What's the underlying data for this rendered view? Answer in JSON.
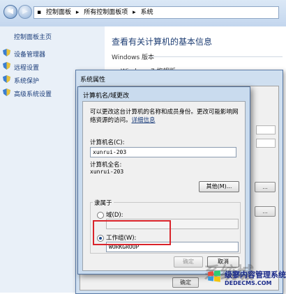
{
  "address_bar": {
    "crumbs": [
      "控制面板",
      "▸",
      "所有控制面板项",
      "▸",
      "系统"
    ]
  },
  "left_nav": {
    "home": "控制面板主页",
    "items": [
      "设备管理器",
      "远程设置",
      "系统保护",
      "高级系统设置"
    ]
  },
  "main": {
    "title": "查看有关计算机的基本信息",
    "windows_version_label": "Windows 版本",
    "windows_edition": "Windows 7 旗舰版"
  },
  "system_properties": {
    "title": "系统属性",
    "ok": "确定"
  },
  "name_dialog": {
    "title": "计算机名/域更改",
    "description_line1": "可以更改这台计算机的名称和成员身份。更改可能影响网",
    "description_line2": "络资源的访问。",
    "more_info_link": "详细信息",
    "computer_name_label": "计算机名(C):",
    "computer_name_value": "xunrui-203",
    "full_name_label": "计算机全名:",
    "full_name_value": "xunrui-203",
    "other_button": "其他(M)...",
    "member_of_label": "隶属于",
    "domain_label": "域(D):",
    "domain_value": "",
    "workgroup_label": "工作组(W):",
    "workgroup_value": "WORKGROUP",
    "ok_button": "确定",
    "cancel_button": "取消"
  },
  "watermark": {
    "cn": "级寥内容管理系统",
    "url": "DEDECMS.COM",
    "big": "系统城"
  },
  "colors": {
    "highlight_border": "#d9232a",
    "link": "#1b3d7a"
  }
}
